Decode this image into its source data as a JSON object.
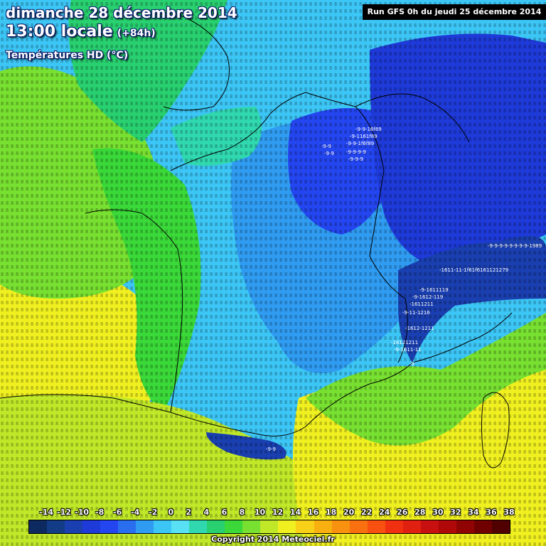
{
  "header": {
    "date": "dimanche 28 décembre 2014",
    "time": "13:00 locale",
    "lead": "(+84h)",
    "variable": "Températures HD (°C)",
    "run": "Run GFS 0h du jeudi 25 décembre 2014"
  },
  "legend": {
    "labels": [
      "-14",
      "-12",
      "-10",
      "-8",
      "-6",
      "-4",
      "-2",
      "0",
      "2",
      "4",
      "6",
      "8",
      "10",
      "12",
      "14",
      "16",
      "18",
      "20",
      "22",
      "24",
      "26",
      "28",
      "30",
      "32",
      "34",
      "36",
      "38"
    ],
    "colors": [
      "#0d2a60",
      "#123c86",
      "#1a3fb0",
      "#1e3ad8",
      "#2446f0",
      "#2a6ef0",
      "#2f9cf2",
      "#3cc6f6",
      "#58e0f4",
      "#30d8b0",
      "#28d070",
      "#3ad838",
      "#78e030",
      "#c0e828",
      "#f0f020",
      "#f8d018",
      "#f8b010",
      "#f89010",
      "#f87010",
      "#f85010",
      "#f03010",
      "#e02010",
      "#c81010",
      "#b00808",
      "#900404",
      "#700000",
      "#500000"
    ]
  },
  "map": {
    "style": {
      "border_color": "#000000",
      "label_color": "#ffffff"
    },
    "cold_labels": [
      "-9-9-16f89",
      "-9-1161f89",
      "-9-9-1f6f89",
      "-9-9-9-9",
      "-9-9-9",
      "-9-9",
      "-9-9",
      "-9-9-9-9-9-9-9-9-1989",
      "-1611-11-1f61f6161121279",
      "-9-1611119",
      "-9-1612-119",
      "-1611211",
      "-9-11-1216",
      "-1612-1211",
      "-16121211",
      "-9-1611-11",
      "-9",
      "-9-9"
    ],
    "corner_figures": {
      "lt_left": "1",
      "rt_top": "8"
    }
  },
  "footer": {
    "copyright": "Copyright 2014 Meteociel.fr"
  }
}
